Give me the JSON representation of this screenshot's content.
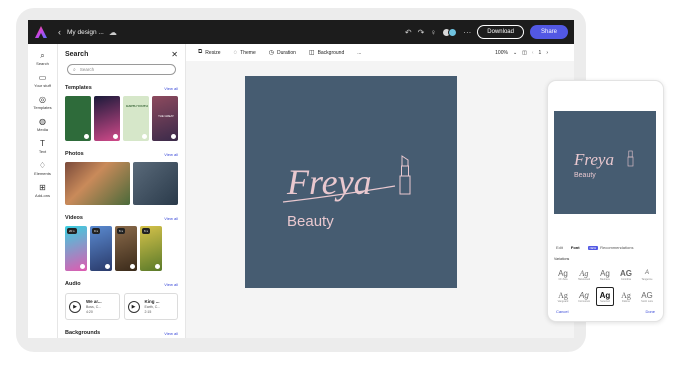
{
  "topbar": {
    "doc_title": "My design ...",
    "download_label": "Download",
    "share_label": "Share"
  },
  "rail": {
    "items": [
      {
        "label": "Search",
        "icon": "search-icon"
      },
      {
        "label": "Your stuff",
        "icon": "folder-icon"
      },
      {
        "label": "Templates",
        "icon": "templates-icon"
      },
      {
        "label": "Media",
        "icon": "media-icon"
      },
      {
        "label": "Text",
        "icon": "text-icon"
      },
      {
        "label": "Elements",
        "icon": "elements-icon"
      },
      {
        "label": "Add-ons",
        "icon": "add-ons-icon"
      }
    ]
  },
  "panel": {
    "title": "Search",
    "search_placeholder": "Search",
    "view_all": "View all",
    "sections": {
      "templates": "Templates",
      "photos": "Photos",
      "videos": "Videos",
      "audio": "Audio",
      "backgrounds": "Backgrounds"
    },
    "template_texts": [
      "EARTH YOUTH",
      "THE GREAT"
    ],
    "video_badges": [
      "20 s",
      "9 s",
      "6 s",
      "6 s"
    ],
    "audio": [
      {
        "title": "We ar...",
        "artist": "Boss, C...",
        "duration": "4:20"
      },
      {
        "title": "King ...",
        "artist": "Earth, C...",
        "duration": "2:15"
      }
    ]
  },
  "toolbar": {
    "resize": "Resize",
    "theme": "Theme",
    "duration": "Duration",
    "background": "Background",
    "more": "...",
    "zoom": "100%",
    "page": "1"
  },
  "canvas": {
    "brand": "Freya",
    "sub": "Beauty",
    "bg_color": "#465c71"
  },
  "phone": {
    "tabs": [
      "Edit",
      "Font",
      "Recommendations"
    ],
    "new_badge": "NEW",
    "label": "Variations",
    "fonts": [
      {
        "ag": "Ag",
        "name": "CF Zeta"
      },
      {
        "ag": "Ag",
        "name": "Hazelwood"
      },
      {
        "ag": "Ag",
        "name": "Bauhaus"
      },
      {
        "ag": "AG",
        "name": "Corinthia"
      },
      {
        "ag": "A",
        "name": "Tangerine"
      },
      {
        "ag": "Ag",
        "name": "Vanguard"
      },
      {
        "ag": "Ag",
        "name": "Cormorant"
      },
      {
        "ag": "Ag",
        "name": "Selected"
      },
      {
        "ag": "Ag",
        "name": "Didone"
      },
      {
        "ag": "AG",
        "name": "Sortir Lora"
      }
    ],
    "cancel": "Cancel",
    "done": "Done"
  }
}
